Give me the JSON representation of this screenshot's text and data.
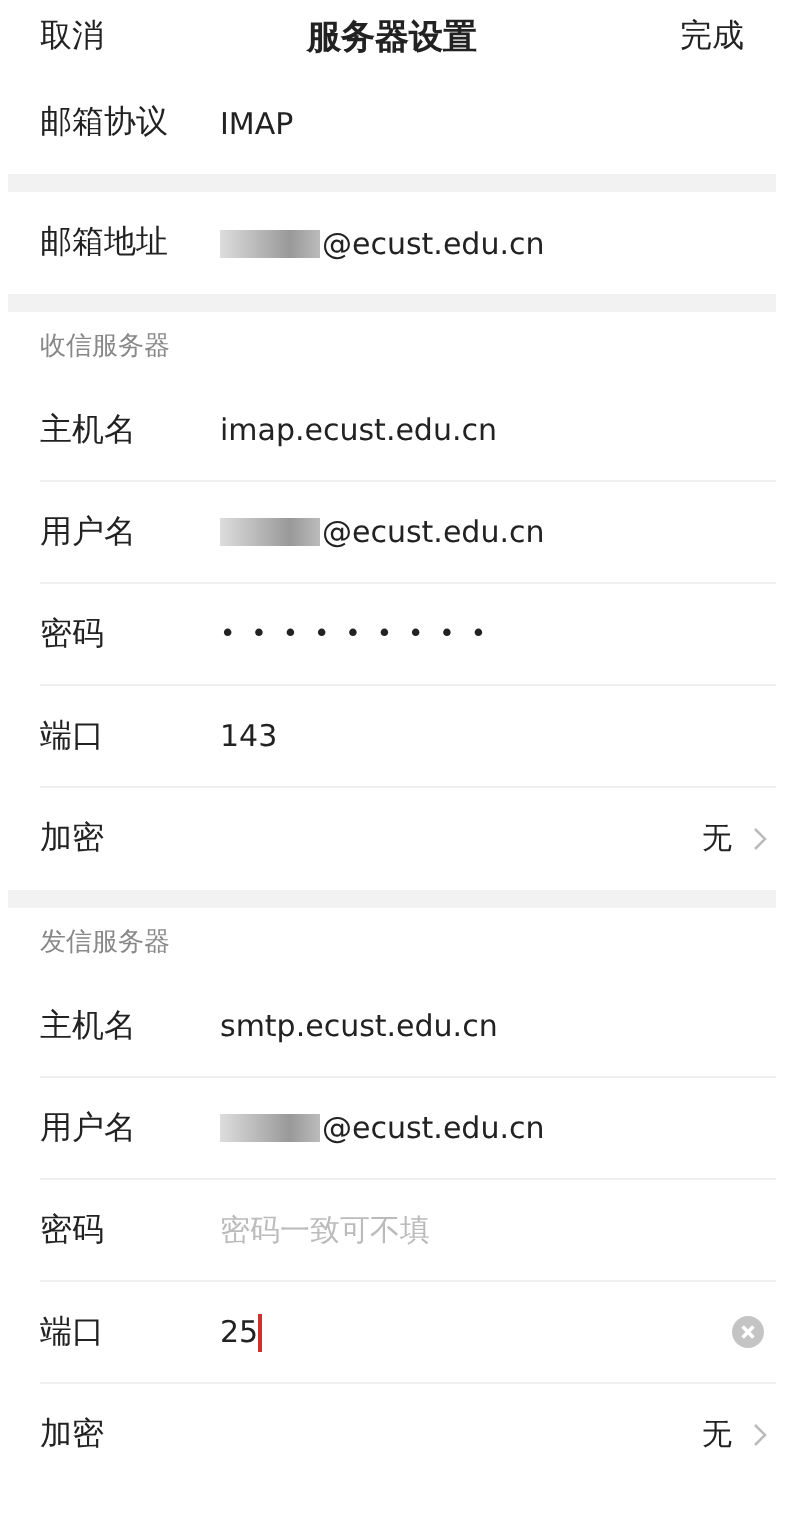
{
  "header": {
    "cancel": "取消",
    "title": "服务器设置",
    "done": "完成"
  },
  "groups": [
    {
      "rows": [
        {
          "kind": "text",
          "label": "邮箱协议",
          "value": "IMAP"
        }
      ]
    },
    {
      "rows": [
        {
          "kind": "text",
          "label": "邮箱地址",
          "value": "@ecust.edu.cn",
          "redacted": true
        }
      ]
    },
    {
      "title": "收信服务器",
      "rows": [
        {
          "kind": "text",
          "label": "主机名",
          "value": "imap.ecust.edu.cn"
        },
        {
          "kind": "text",
          "label": "用户名",
          "value": "@ecust.edu.cn",
          "redacted": true
        },
        {
          "kind": "password",
          "label": "密码",
          "value": "•••••••••"
        },
        {
          "kind": "text",
          "label": "端口",
          "value": "143"
        },
        {
          "kind": "select",
          "label": "加密",
          "value": "无"
        }
      ]
    },
    {
      "title": "发信服务器",
      "rows": [
        {
          "kind": "text",
          "label": "主机名",
          "value": "smtp.ecust.edu.cn"
        },
        {
          "kind": "text",
          "label": "用户名",
          "value": "@ecust.edu.cn",
          "redacted": true
        },
        {
          "kind": "password",
          "label": "密码",
          "placeholder": "密码一致可不填"
        },
        {
          "kind": "text",
          "label": "端口",
          "value": "25",
          "focused": true
        },
        {
          "kind": "select",
          "label": "加密",
          "value": "无"
        }
      ]
    }
  ]
}
